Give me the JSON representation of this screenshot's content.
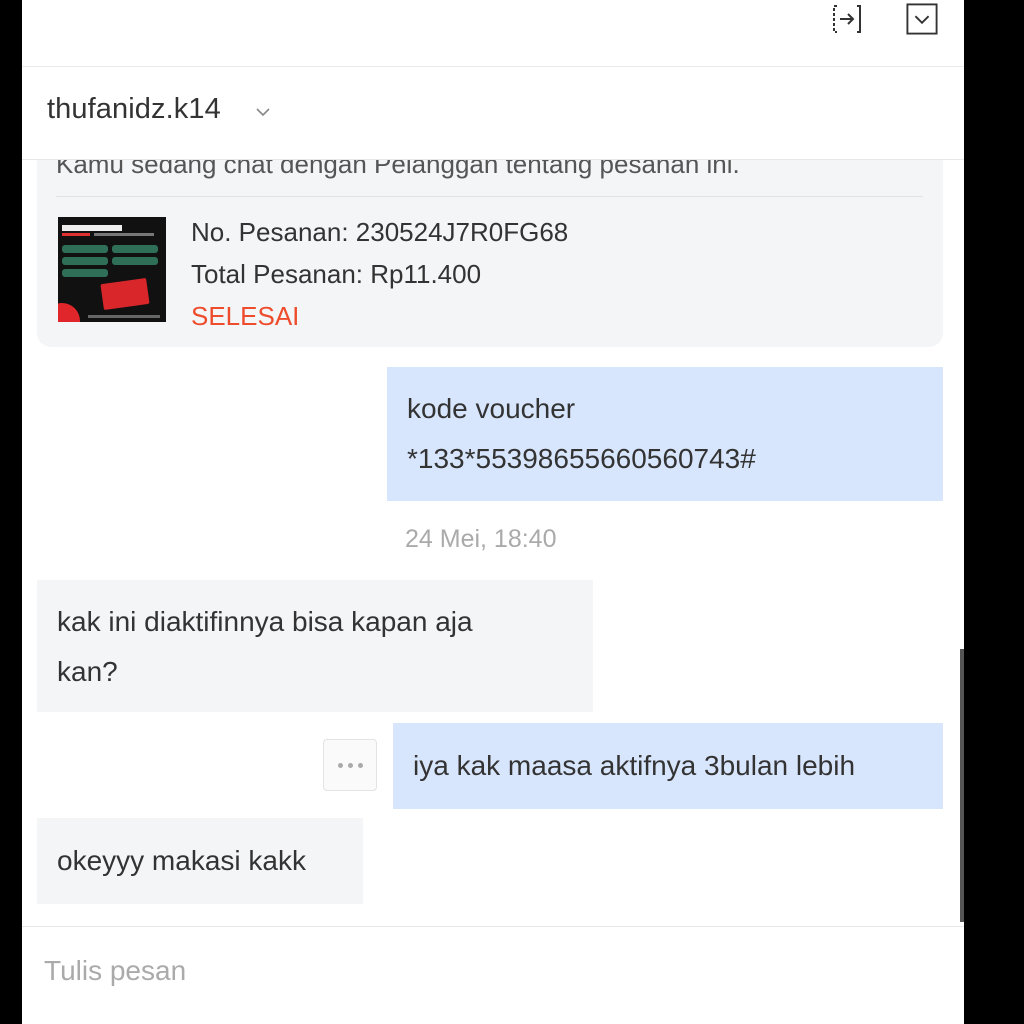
{
  "header": {
    "username": "thufanidz.k14",
    "icons": {
      "exit": "exit-chat-icon",
      "collapse": "collapse-icon",
      "dropdown": "chevron-down-icon"
    }
  },
  "order_card": {
    "notice": "Kamu sedang chat dengan Pelanggan tentang pesanan ini.",
    "order_number": "No. Pesanan: 230524J7R0FG68",
    "total": "Total Pesanan: Rp11.400",
    "status": "SELESAI",
    "status_color": "#ee4d2d"
  },
  "messages": [
    {
      "direction": "out",
      "lines": [
        "kode voucher",
        "*133*5539865566056074 3#"
      ]
    },
    {
      "timestamp": "24 Mei, 18:40"
    },
    {
      "direction": "in",
      "lines": [
        "kak ini diaktifinnya bisa kapan aja",
        "kan?"
      ]
    },
    {
      "direction": "out",
      "text": "iya kak maasa aktifnya 3bulan lebih"
    },
    {
      "direction": "in",
      "text": "okeyyy makasi kakk"
    }
  ],
  "composer": {
    "placeholder": "Tulis pesan"
  },
  "colors": {
    "outgoing_bubble": "#d8e6fd",
    "incoming_bubble": "#f4f5f7",
    "accent": "#ee4d2d"
  }
}
